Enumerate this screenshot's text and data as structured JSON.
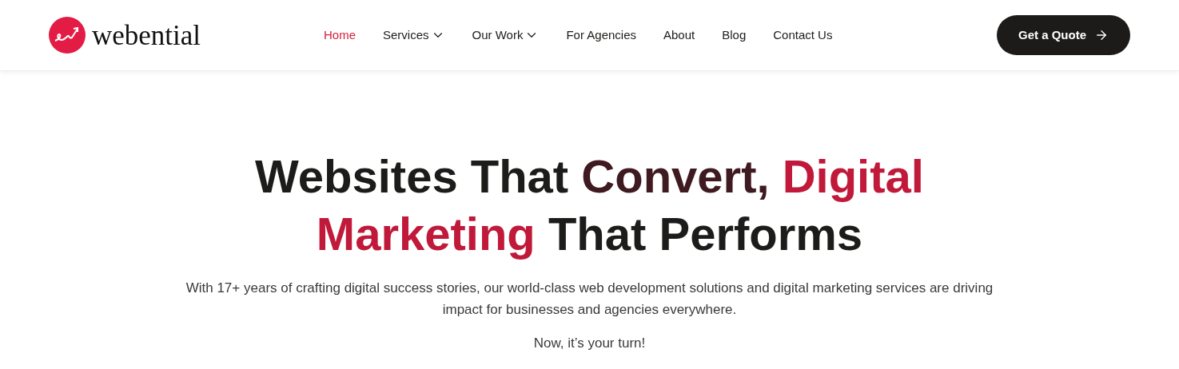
{
  "logo": {
    "text": "webential"
  },
  "nav": [
    {
      "label": "Home",
      "selected": true,
      "dropdown": false
    },
    {
      "label": "Services",
      "selected": false,
      "dropdown": true
    },
    {
      "label": "Our Work",
      "selected": false,
      "dropdown": true
    },
    {
      "label": "For Agencies",
      "selected": false,
      "dropdown": false
    },
    {
      "label": "About",
      "selected": false,
      "dropdown": false
    },
    {
      "label": "Blog",
      "selected": false,
      "dropdown": false
    },
    {
      "label": "Contact Us",
      "selected": false,
      "dropdown": false
    }
  ],
  "cta_button": {
    "label": "Get a Quote"
  },
  "hero": {
    "headline": [
      {
        "text": "Websites That ",
        "kind": "plain"
      },
      {
        "text": "Convert, ",
        "kind": "dark-accent"
      },
      {
        "text": "Digital Marketing",
        "kind": "accent"
      },
      {
        "text": " That Performs",
        "kind": "plain"
      }
    ],
    "description": "With 17+ years of crafting digital success stories, our world-class web development solutions and digital marketing services are driving impact for businesses and agencies everywhere.",
    "tagline": "Now, it’s your turn!"
  }
}
